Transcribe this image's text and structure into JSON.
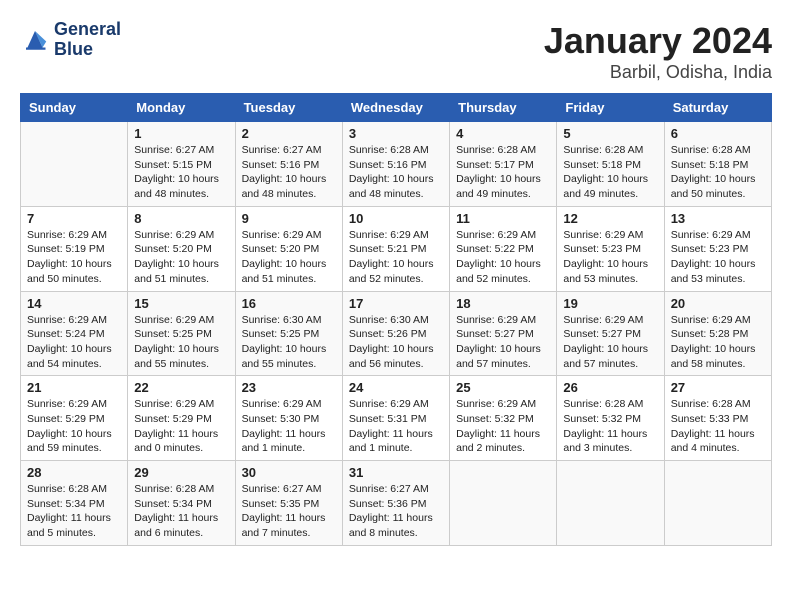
{
  "header": {
    "logo": {
      "line1": "General",
      "line2": "Blue"
    },
    "month_year": "January 2024",
    "location": "Barbil, Odisha, India"
  },
  "days_of_week": [
    "Sunday",
    "Monday",
    "Tuesday",
    "Wednesday",
    "Thursday",
    "Friday",
    "Saturday"
  ],
  "weeks": [
    [
      {
        "day": "",
        "info": ""
      },
      {
        "day": "1",
        "info": "Sunrise: 6:27 AM\nSunset: 5:15 PM\nDaylight: 10 hours\nand 48 minutes."
      },
      {
        "day": "2",
        "info": "Sunrise: 6:27 AM\nSunset: 5:16 PM\nDaylight: 10 hours\nand 48 minutes."
      },
      {
        "day": "3",
        "info": "Sunrise: 6:28 AM\nSunset: 5:16 PM\nDaylight: 10 hours\nand 48 minutes."
      },
      {
        "day": "4",
        "info": "Sunrise: 6:28 AM\nSunset: 5:17 PM\nDaylight: 10 hours\nand 49 minutes."
      },
      {
        "day": "5",
        "info": "Sunrise: 6:28 AM\nSunset: 5:18 PM\nDaylight: 10 hours\nand 49 minutes."
      },
      {
        "day": "6",
        "info": "Sunrise: 6:28 AM\nSunset: 5:18 PM\nDaylight: 10 hours\nand 50 minutes."
      }
    ],
    [
      {
        "day": "7",
        "info": "Sunrise: 6:29 AM\nSunset: 5:19 PM\nDaylight: 10 hours\nand 50 minutes."
      },
      {
        "day": "8",
        "info": "Sunrise: 6:29 AM\nSunset: 5:20 PM\nDaylight: 10 hours\nand 51 minutes."
      },
      {
        "day": "9",
        "info": "Sunrise: 6:29 AM\nSunset: 5:20 PM\nDaylight: 10 hours\nand 51 minutes."
      },
      {
        "day": "10",
        "info": "Sunrise: 6:29 AM\nSunset: 5:21 PM\nDaylight: 10 hours\nand 52 minutes."
      },
      {
        "day": "11",
        "info": "Sunrise: 6:29 AM\nSunset: 5:22 PM\nDaylight: 10 hours\nand 52 minutes."
      },
      {
        "day": "12",
        "info": "Sunrise: 6:29 AM\nSunset: 5:23 PM\nDaylight: 10 hours\nand 53 minutes."
      },
      {
        "day": "13",
        "info": "Sunrise: 6:29 AM\nSunset: 5:23 PM\nDaylight: 10 hours\nand 53 minutes."
      }
    ],
    [
      {
        "day": "14",
        "info": "Sunrise: 6:29 AM\nSunset: 5:24 PM\nDaylight: 10 hours\nand 54 minutes."
      },
      {
        "day": "15",
        "info": "Sunrise: 6:29 AM\nSunset: 5:25 PM\nDaylight: 10 hours\nand 55 minutes."
      },
      {
        "day": "16",
        "info": "Sunrise: 6:30 AM\nSunset: 5:25 PM\nDaylight: 10 hours\nand 55 minutes."
      },
      {
        "day": "17",
        "info": "Sunrise: 6:30 AM\nSunset: 5:26 PM\nDaylight: 10 hours\nand 56 minutes."
      },
      {
        "day": "18",
        "info": "Sunrise: 6:29 AM\nSunset: 5:27 PM\nDaylight: 10 hours\nand 57 minutes."
      },
      {
        "day": "19",
        "info": "Sunrise: 6:29 AM\nSunset: 5:27 PM\nDaylight: 10 hours\nand 57 minutes."
      },
      {
        "day": "20",
        "info": "Sunrise: 6:29 AM\nSunset: 5:28 PM\nDaylight: 10 hours\nand 58 minutes."
      }
    ],
    [
      {
        "day": "21",
        "info": "Sunrise: 6:29 AM\nSunset: 5:29 PM\nDaylight: 10 hours\nand 59 minutes."
      },
      {
        "day": "22",
        "info": "Sunrise: 6:29 AM\nSunset: 5:29 PM\nDaylight: 11 hours\nand 0 minutes."
      },
      {
        "day": "23",
        "info": "Sunrise: 6:29 AM\nSunset: 5:30 PM\nDaylight: 11 hours\nand 1 minute."
      },
      {
        "day": "24",
        "info": "Sunrise: 6:29 AM\nSunset: 5:31 PM\nDaylight: 11 hours\nand 1 minute."
      },
      {
        "day": "25",
        "info": "Sunrise: 6:29 AM\nSunset: 5:32 PM\nDaylight: 11 hours\nand 2 minutes."
      },
      {
        "day": "26",
        "info": "Sunrise: 6:28 AM\nSunset: 5:32 PM\nDaylight: 11 hours\nand 3 minutes."
      },
      {
        "day": "27",
        "info": "Sunrise: 6:28 AM\nSunset: 5:33 PM\nDaylight: 11 hours\nand 4 minutes."
      }
    ],
    [
      {
        "day": "28",
        "info": "Sunrise: 6:28 AM\nSunset: 5:34 PM\nDaylight: 11 hours\nand 5 minutes."
      },
      {
        "day": "29",
        "info": "Sunrise: 6:28 AM\nSunset: 5:34 PM\nDaylight: 11 hours\nand 6 minutes."
      },
      {
        "day": "30",
        "info": "Sunrise: 6:27 AM\nSunset: 5:35 PM\nDaylight: 11 hours\nand 7 minutes."
      },
      {
        "day": "31",
        "info": "Sunrise: 6:27 AM\nSunset: 5:36 PM\nDaylight: 11 hours\nand 8 minutes."
      },
      {
        "day": "",
        "info": ""
      },
      {
        "day": "",
        "info": ""
      },
      {
        "day": "",
        "info": ""
      }
    ]
  ]
}
